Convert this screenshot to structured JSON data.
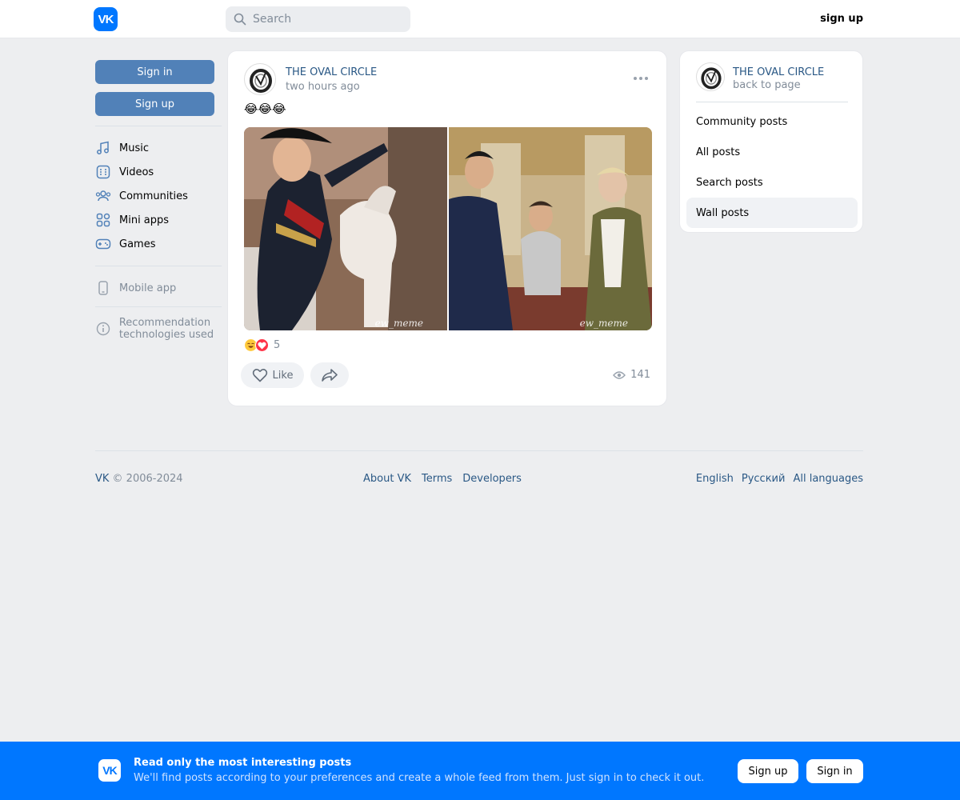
{
  "header": {
    "logo_text": "VK",
    "search_placeholder": "Search",
    "signup_label": "sign up"
  },
  "leftnav": {
    "signin_label": "Sign in",
    "signup_label": "Sign up",
    "items": [
      {
        "label": "Music",
        "icon": "music-icon"
      },
      {
        "label": "Videos",
        "icon": "video-icon"
      },
      {
        "label": "Communities",
        "icon": "communities-icon"
      },
      {
        "label": "Mini apps",
        "icon": "mini-apps-icon"
      },
      {
        "label": "Games",
        "icon": "gamepad-icon"
      }
    ],
    "mobile_app": "Mobile app",
    "recommendation": "Recommendation technologies used"
  },
  "post": {
    "author": "THE OVAL CIRCLE",
    "time": "two hours ago",
    "text": "😂😂😂",
    "watermark1": "ew_meme",
    "watermark2": "ew_meme",
    "reactions": [
      "laughing",
      "heart"
    ],
    "reaction_count": "5",
    "like_label": "Like",
    "views": "141"
  },
  "rightcard": {
    "name": "THE OVAL CIRCLE",
    "back": "back to page",
    "menu": [
      {
        "label": "Community posts",
        "active": false
      },
      {
        "label": "All posts",
        "active": false
      },
      {
        "label": "Search posts",
        "active": false
      },
      {
        "label": "Wall posts",
        "active": true
      }
    ]
  },
  "footer": {
    "vk": "VK",
    "copyright": " © 2006-2024",
    "links": [
      "About VK",
      "Terms",
      "Developers"
    ],
    "languages": [
      "English",
      "Русский",
      "All languages"
    ]
  },
  "banner": {
    "logo_text": "VK",
    "title": "Read only the most interesting posts",
    "subtitle": "We'll find posts according to your preferences and create a whole feed from them. Just sign in to check it out.",
    "signup_label": "Sign up",
    "signin_label": "Sign in"
  },
  "colors": {
    "brand": "#0077ff",
    "button_blue": "#5181b8",
    "link": "#2a5885",
    "background": "#edeef0"
  }
}
